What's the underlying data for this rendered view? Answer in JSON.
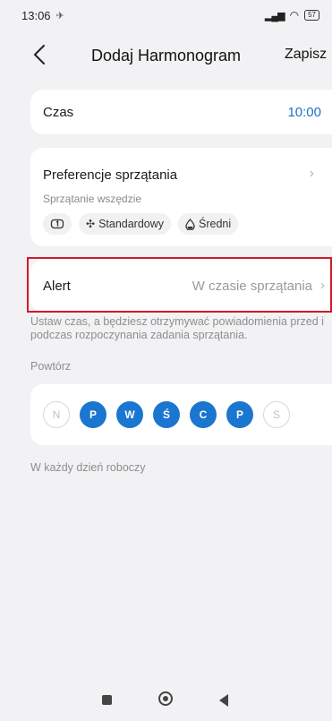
{
  "status": {
    "time": "13:06",
    "battery": "57"
  },
  "header": {
    "title": "Dodaj Harmonogram",
    "save": "Zapisz"
  },
  "time_row": {
    "label": "Czas",
    "value": "10:00"
  },
  "preferences": {
    "title": "Preferencje sprzątania",
    "subtitle": "Sprzątanie wszędzie",
    "chips": [
      {
        "icon": "loop-icon",
        "label": ""
      },
      {
        "icon": "fan-icon",
        "label": "Standardowy"
      },
      {
        "icon": "water-drop-icon",
        "label": "Średni"
      }
    ]
  },
  "alert": {
    "label": "Alert",
    "value": "W czasie sprzątania",
    "hint": "Ustaw czas, a będziesz otrzymywać powiadomienia przed i podczas rozpoczynania zadania sprzątania."
  },
  "repeat": {
    "label": "Powtórz",
    "days": [
      {
        "letter": "N",
        "active": false
      },
      {
        "letter": "P",
        "active": true
      },
      {
        "letter": "W",
        "active": true
      },
      {
        "letter": "Ś",
        "active": true
      },
      {
        "letter": "C",
        "active": true
      },
      {
        "letter": "P",
        "active": true
      },
      {
        "letter": "S",
        "active": false
      }
    ],
    "summary": "W każdy dzień roboczy"
  },
  "colors": {
    "accent": "#1a76cf",
    "highlight": "#d11a2a",
    "background": "#f2f2f4"
  }
}
